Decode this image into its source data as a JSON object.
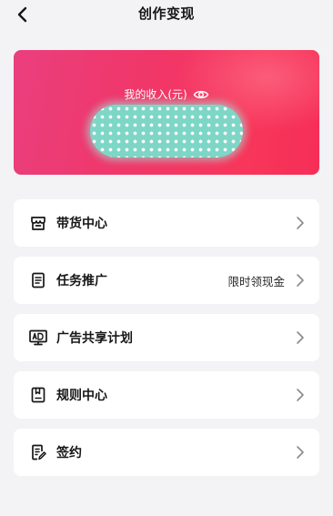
{
  "header": {
    "title": "创作变现"
  },
  "income": {
    "label": "我的收入(元)",
    "accent": "#f0376a"
  },
  "menu": {
    "items": [
      {
        "label": "带货中心",
        "extra": "",
        "icon": "store-icon"
      },
      {
        "label": "任务推广",
        "extra": "限时领现金",
        "icon": "document-icon"
      },
      {
        "label": "广告共享计划",
        "extra": "",
        "icon": "ad-monitor-icon"
      },
      {
        "label": "规则中心",
        "extra": "",
        "icon": "rulebook-icon"
      },
      {
        "label": "签约",
        "extra": "",
        "icon": "contract-sign-icon"
      }
    ]
  },
  "colors": {
    "background": "#f3f3f5",
    "card": "#ffffff",
    "text": "#161616"
  }
}
